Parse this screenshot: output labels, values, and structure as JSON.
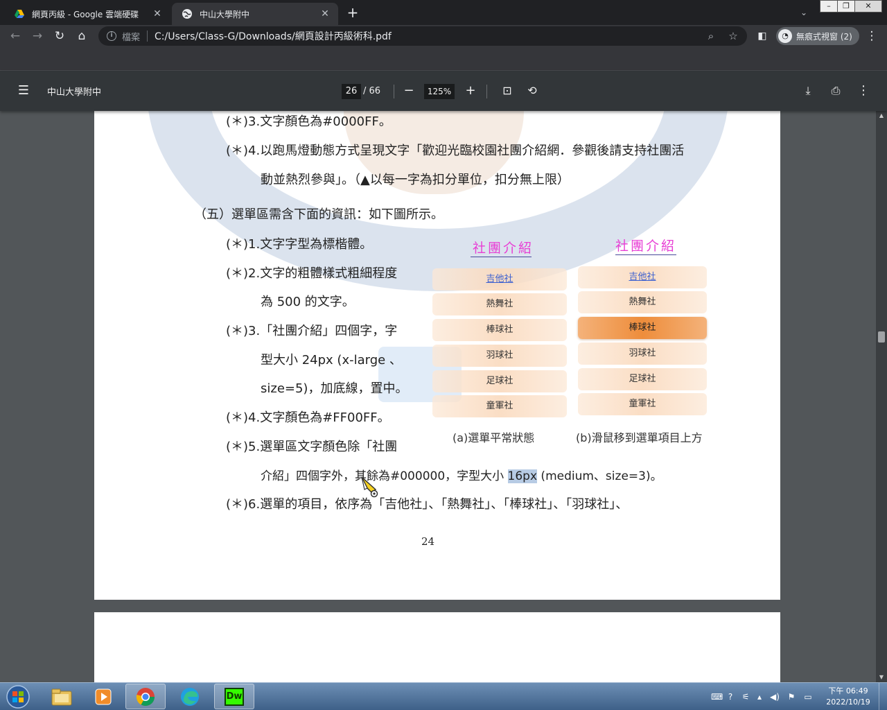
{
  "browser": {
    "tabs": [
      {
        "title": "網頁丙級 - Google 雲端硬碟",
        "favicon": "google-drive-icon",
        "active": false
      },
      {
        "title": "中山大學附中",
        "favicon": "globe-icon",
        "active": true
      }
    ],
    "omnibox": {
      "security_label": "檔案",
      "url": "C:/Users/Class-G/Downloads/網頁設計丙級術科.pdf"
    },
    "profile_label": "無痕式視窗 (2)"
  },
  "pdf_viewer": {
    "title": "中山大學附中",
    "current_page": "26",
    "total_pages": "66",
    "zoom": "125%",
    "page_number_label": "24"
  },
  "document": {
    "lines": [
      "(＊)3.文字顏色為#0000FF。",
      "(＊)4.以跑馬燈動態方式呈現文字「歡迎光臨校園社團介紹網．參觀後請支持社團活",
      "動並熱烈參與」。（▲以每一字為扣分單位，扣分無上限）",
      "（五）選單區需含下面的資訊：如下圖所示。",
      "(＊)1.文字字型為標楷體。",
      "(＊)2.文字的粗體樣式粗細程度",
      "為 500 的文字。",
      "(＊)3.「社團介紹」四個字，字",
      "型大小  24px  (x-large 、",
      "size=5)，加底線，置中。",
      "(＊)4.文字顏色為#FF00FF。",
      "(＊)5.選單區文字顏色除「社團",
      "(＊)6.選單的項目，依序為「吉他社」、「熱舞社」、「棒球社」、「羽球社」、"
    ],
    "line11_before": "介紹」四個字外，其餘為#000000，字型大小 ",
    "line11_highlight": "16px",
    "line11_after": " (medium、size=3)。"
  },
  "figure": {
    "menu_title": "社團介紹",
    "items": [
      "吉他社",
      "熱舞社",
      "棒球社",
      "羽球社",
      "足球社",
      "童軍社"
    ],
    "caption_a": "(a)選單平常狀態",
    "caption_b": "(b)滑鼠移到選單項目上方",
    "hover_item_index": 2,
    "colors": {
      "title": "#e83fd5",
      "link": "#3a5fd0",
      "hover": "#ee8d3b",
      "normal": "#fadabe"
    }
  },
  "taskbar": {
    "apps": [
      "file-explorer-icon",
      "media-player-icon",
      "chrome-icon",
      "edge-icon",
      "dreamweaver-icon"
    ],
    "dreamweaver_label": "Dw",
    "clock_time": "下午 06:49",
    "clock_date": "2022/10/19"
  }
}
